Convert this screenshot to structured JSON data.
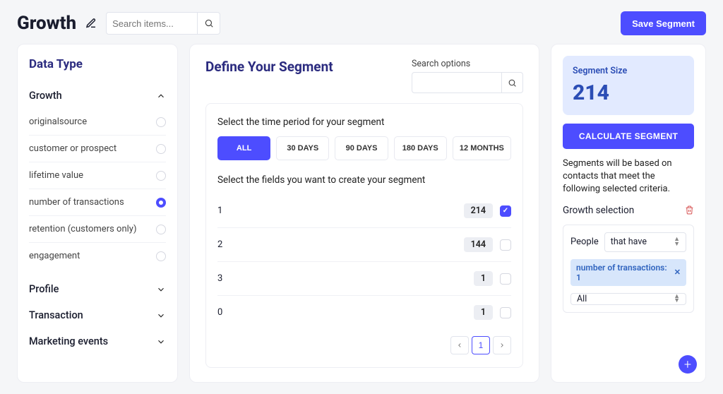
{
  "header": {
    "title": "Growth",
    "search_placeholder": "Search items...",
    "save_label": "Save Segment"
  },
  "sidebar": {
    "heading": "Data Type",
    "sections": [
      {
        "title": "Growth",
        "expanded": true,
        "fields": [
          {
            "label": "originalsource",
            "selected": false
          },
          {
            "label": "customer or prospect",
            "selected": false
          },
          {
            "label": "lifetime value",
            "selected": false
          },
          {
            "label": "number of transactions",
            "selected": true
          },
          {
            "label": "retention (customers only)",
            "selected": false
          },
          {
            "label": "engagement",
            "selected": false
          }
        ]
      },
      {
        "title": "Profile",
        "expanded": false
      },
      {
        "title": "Transaction",
        "expanded": false
      },
      {
        "title": "Marketing events",
        "expanded": false
      }
    ]
  },
  "center": {
    "heading": "Define Your Segment",
    "search_options_label": "Search options",
    "period_label": "Select the time period for your segment",
    "periods": [
      {
        "label": "ALL",
        "active": true
      },
      {
        "label": "30 DAYS",
        "active": false
      },
      {
        "label": "90 DAYS",
        "active": false
      },
      {
        "label": "180 DAYS",
        "active": false
      },
      {
        "label": "12 MONTHS",
        "active": false
      }
    ],
    "fields_label": "Select the fields you want to create your segment",
    "rows": [
      {
        "label": "1",
        "count": "214",
        "checked": true
      },
      {
        "label": "2",
        "count": "144",
        "checked": false
      },
      {
        "label": "3",
        "count": "1",
        "checked": false
      },
      {
        "label": "0",
        "count": "1",
        "checked": false
      }
    ],
    "pager": {
      "current": "1"
    }
  },
  "right": {
    "size_label": "Segment Size",
    "size_value": "214",
    "calc_label": "CALCULATE SEGMENT",
    "description": "Segments will be based on contacts that meet the following selected criteria.",
    "selection_heading": "Growth selection",
    "criteria": {
      "people_label": "People",
      "people_select": "that have",
      "tag": "number of transactions: 1",
      "all_select": "All"
    }
  }
}
